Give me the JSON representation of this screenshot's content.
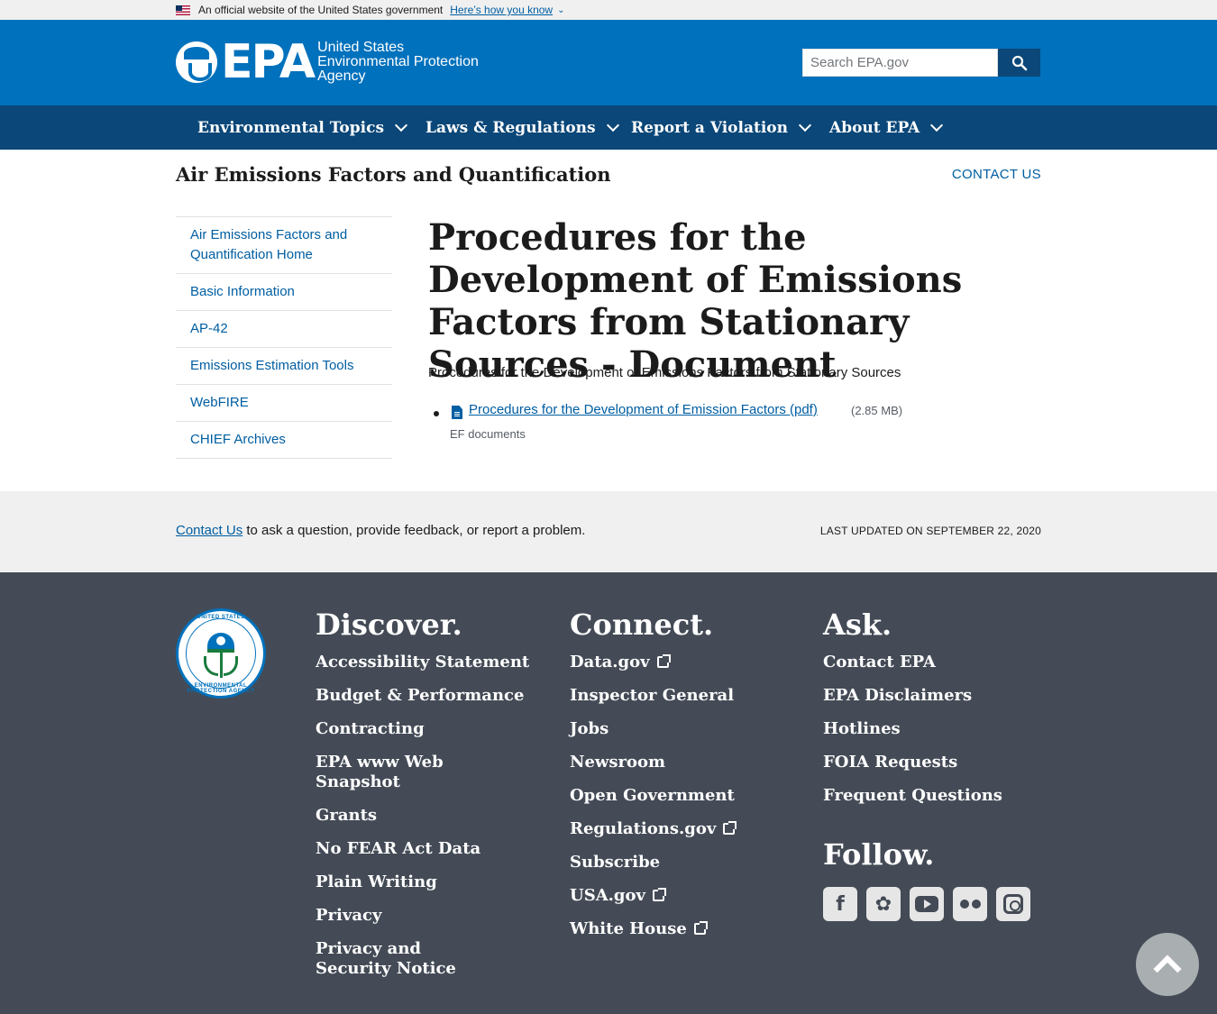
{
  "banner": {
    "official": "An official website of the United States government",
    "how_know": "Here’s how you know"
  },
  "header": {
    "logo_letters": "EPA",
    "agency_line1": "United States",
    "agency_line2": "Environmental Protection",
    "agency_line3": "Agency",
    "search_placeholder": "Search EPA.gov"
  },
  "nav": [
    {
      "label": "Environmental Topics"
    },
    {
      "label": "Laws & Regulations"
    },
    {
      "label": "Report a Violation"
    },
    {
      "label": "About EPA"
    }
  ],
  "section": {
    "title": "Air Emissions Factors and Quantification",
    "contact": "CONTACT US"
  },
  "sidenav": [
    {
      "label": "Air Emissions Factors and Quantification Home"
    },
    {
      "label": "Basic Information"
    },
    {
      "label": "AP-42"
    },
    {
      "label": "Emissions Estimation Tools"
    },
    {
      "label": "WebFIRE"
    },
    {
      "label": "CHIEF Archives"
    }
  ],
  "main": {
    "title": "Procedures for the Development of Emissions Factors from Stationary Sources - Document",
    "intro": "Procedures for the Development of Emissions Factors from Stationary Sources",
    "doc_link": "Procedures for the Development of Emission Factors (pdf)",
    "doc_size": "(2.85 MB)",
    "doc_sub": "EF documents"
  },
  "contact_bar": {
    "link": "Contact Us",
    "text": " to ask a question, provide feedback, or report a problem.",
    "updated": "LAST UPDATED ON SEPTEMBER 22, 2020"
  },
  "footer": {
    "seal_top": "UNITED STATES",
    "seal_bottom": "ENVIRONMENTAL PROTECTION AGENCY",
    "discover": {
      "heading": "Discover.",
      "links": [
        "Accessibility Statement",
        "Budget & Performance",
        "Contracting",
        "EPA www Web Snapshot",
        "Grants",
        "No FEAR Act Data",
        "Plain Writing",
        "Privacy",
        "Privacy and Security Notice"
      ]
    },
    "connect": {
      "heading": "Connect.",
      "links": [
        "Data.gov",
        "Inspector General",
        "Jobs",
        "Newsroom",
        "Open Government",
        "Regulations.gov",
        "Subscribe",
        "USA.gov",
        "White House"
      ]
    },
    "ask": {
      "heading": "Ask.",
      "links": [
        "Contact EPA",
        "EPA Disclaimers",
        "Hotlines",
        "FOIA Requests",
        "Frequent Questions"
      ]
    },
    "follow": {
      "heading": "Follow.",
      "icons": [
        "facebook-icon",
        "twitter-icon",
        "youtube-icon",
        "flickr-icon",
        "instagram-icon"
      ]
    }
  },
  "colors": {
    "header_blue": "#0071bc",
    "nav_dark_blue": "#0b4778",
    "link_blue": "#005ea2",
    "footer_gray": "#444b56"
  }
}
